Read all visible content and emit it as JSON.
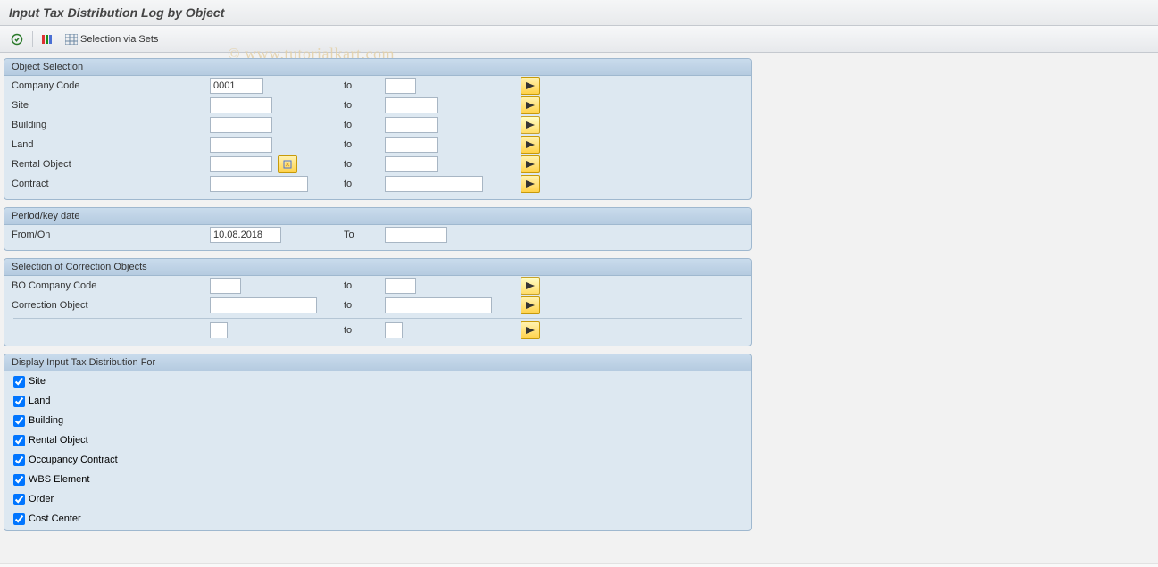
{
  "title": "Input Tax Distribution Log by Object",
  "watermark": "© www.tutorialkart.com",
  "toolbar": {
    "selection_via_sets": "Selection via Sets"
  },
  "groups": {
    "object_selection": {
      "title": "Object Selection",
      "rows": {
        "company_code": {
          "label": "Company Code",
          "from": "0001",
          "to_label": "to",
          "to": ""
        },
        "site": {
          "label": "Site",
          "from": "",
          "to_label": "to",
          "to": ""
        },
        "building": {
          "label": "Building",
          "from": "",
          "to_label": "to",
          "to": ""
        },
        "land": {
          "label": "Land",
          "from": "",
          "to_label": "to",
          "to": ""
        },
        "rental_obj": {
          "label": "Rental Object",
          "from": "",
          "to_label": "to",
          "to": ""
        },
        "contract": {
          "label": "Contract",
          "from": "",
          "to_label": "to",
          "to": ""
        }
      }
    },
    "period": {
      "title": "Period/key date",
      "from_on_label": "From/On",
      "from_on": "10.08.2018",
      "to_label": "To",
      "to": ""
    },
    "correction": {
      "title": "Selection of Correction Objects",
      "rows": {
        "bo_company": {
          "label": "BO Company Code",
          "from": "",
          "to_label": "to",
          "to": ""
        },
        "corr_obj": {
          "label": "Correction Object",
          "from": "",
          "to_label": "to",
          "to": ""
        },
        "blank": {
          "label": "",
          "from": "",
          "to_label": "to",
          "to": ""
        }
      }
    },
    "display_for": {
      "title": "Display Input Tax Distribution For",
      "items": [
        {
          "key": "site",
          "label": "Site",
          "checked": true
        },
        {
          "key": "land",
          "label": "Land",
          "checked": true
        },
        {
          "key": "building",
          "label": "Building",
          "checked": true
        },
        {
          "key": "rental",
          "label": "Rental Object",
          "checked": true
        },
        {
          "key": "occ",
          "label": "Occupancy Contract",
          "checked": true
        },
        {
          "key": "wbs",
          "label": "WBS Element",
          "checked": true
        },
        {
          "key": "order",
          "label": "Order",
          "checked": true
        },
        {
          "key": "cost",
          "label": "Cost Center",
          "checked": true
        }
      ]
    }
  }
}
